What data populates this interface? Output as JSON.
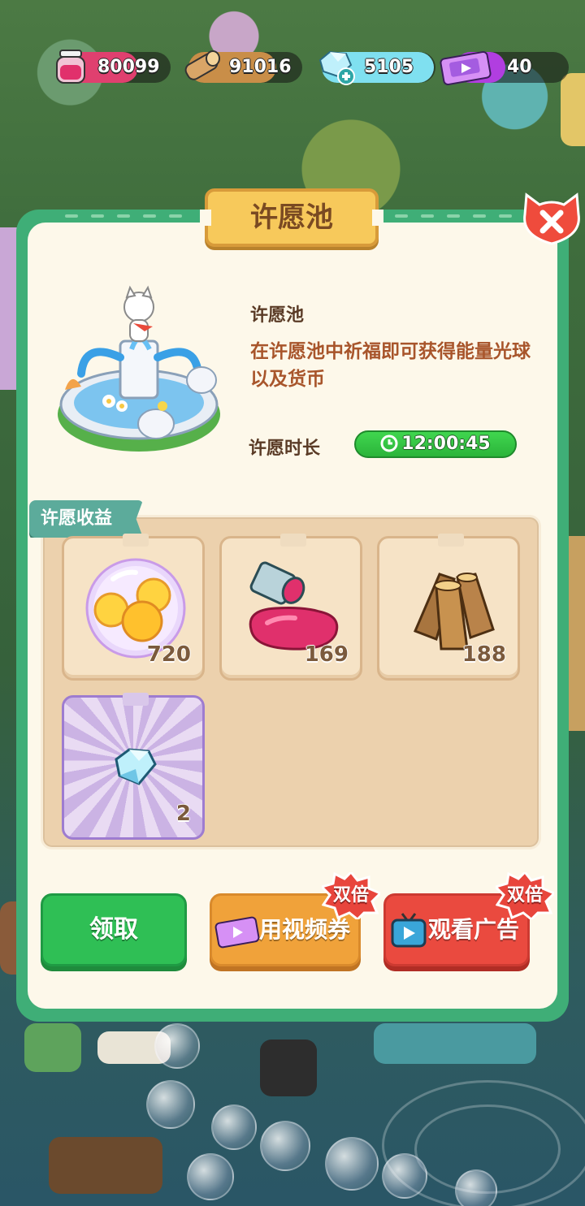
{
  "resources": {
    "paint": "80099",
    "wood": "91016",
    "crystal": "5105",
    "ticket": "40"
  },
  "dialog": {
    "title": "许愿池",
    "info_title": "许愿池",
    "info_desc": "在许愿池中祈福即可获得能量光球以及货币",
    "duration_label": "许愿时长",
    "duration_value": "12:00:45",
    "rewards_label": "许愿收益",
    "rewards": [
      {
        "icon": "energy-orb-icon",
        "count": "720"
      },
      {
        "icon": "paint-bucket-icon",
        "count": "169"
      },
      {
        "icon": "wood-logs-icon",
        "count": "188"
      },
      {
        "icon": "crystal-icon",
        "count": "2"
      }
    ],
    "buttons": {
      "claim": "领取",
      "video_ticket": "用视频券",
      "watch_ad": "观看广告",
      "double_badge": "双倍"
    }
  },
  "colors": {
    "frame_green": "#3fae77",
    "panel_cream": "#fdf8ea",
    "title_gold": "#f7c95b",
    "button_green": "#2fbf55",
    "button_orange": "#f0a23a",
    "button_red": "#ea4a3f",
    "timer_green": "#40d64f"
  }
}
